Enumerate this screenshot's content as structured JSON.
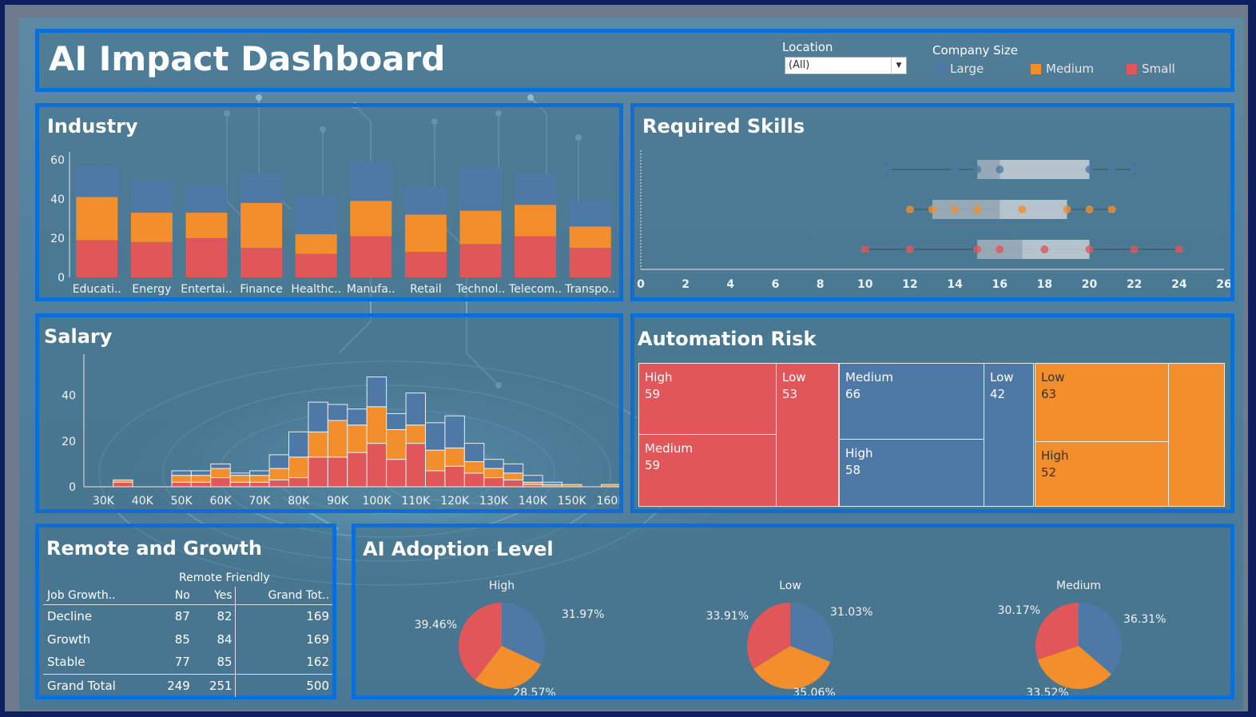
{
  "header": {
    "title": "AI Impact Dashboard",
    "location_label": "Location",
    "location_value": "(All)",
    "size_legend_title": "Company Size",
    "legend": [
      {
        "label": "Large",
        "color": "#4e79a7"
      },
      {
        "label": "Medium",
        "color": "#f28e2b"
      },
      {
        "label": "Small",
        "color": "#e15759"
      }
    ]
  },
  "colors": {
    "large": "#4e79a7",
    "medium": "#f28e2b",
    "small": "#e15759",
    "border": "#0a6fd8"
  },
  "industry": {
    "title": "Industry",
    "chart_data": {
      "type": "bar",
      "stacked": true,
      "categories": [
        "Educati..",
        "Energy",
        "Entertai..",
        "Finance",
        "Healthc..",
        "Manufa..",
        "Retail",
        "Technol..",
        "Telecom..",
        "Transpo.."
      ],
      "series": [
        {
          "name": "Small",
          "values": [
            19,
            18,
            20,
            15,
            12,
            21,
            13,
            17,
            21,
            15
          ]
        },
        {
          "name": "Medium",
          "values": [
            22,
            15,
            13,
            23,
            10,
            18,
            19,
            17,
            16,
            11
          ]
        },
        {
          "name": "Large",
          "values": [
            16,
            16,
            14,
            15,
            20,
            20,
            14,
            22,
            16,
            13
          ]
        }
      ],
      "ylim": [
        0,
        64
      ],
      "yticks": [
        0,
        20,
        40,
        60
      ]
    }
  },
  "skills": {
    "title": "Required Skills",
    "chart_data": {
      "type": "scatter",
      "subtype": "boxplot",
      "xlim": [
        0,
        26
      ],
      "xticks": [
        0,
        2,
        4,
        6,
        8,
        10,
        12,
        14,
        16,
        18,
        20,
        22,
        24,
        26
      ],
      "series": [
        {
          "name": "Large",
          "points": [
            11,
            14,
            15,
            16,
            20,
            21,
            22
          ],
          "min": 11,
          "q1": 15,
          "median": 16,
          "q3": 20,
          "max": 22
        },
        {
          "name": "Medium",
          "points": [
            12,
            13,
            14,
            15,
            17,
            19,
            20,
            21
          ],
          "min": 12,
          "q1": 13,
          "median": 16,
          "q3": 19,
          "max": 21
        },
        {
          "name": "Small",
          "points": [
            10,
            12,
            15,
            16,
            18,
            20,
            22,
            24
          ],
          "min": 10,
          "q1": 15,
          "median": 17,
          "q3": 20,
          "max": 24
        }
      ]
    }
  },
  "salary": {
    "title": "Salary",
    "chart_data": {
      "type": "bar",
      "stacked": true,
      "histogram": true,
      "bin_width": 5000,
      "x_start": 30000,
      "xticks": [
        "30K",
        "40K",
        "50K",
        "60K",
        "70K",
        "80K",
        "90K",
        "100K",
        "110K",
        "120K",
        "130K",
        "140K",
        "150K",
        "160K"
      ],
      "ylim": [
        0,
        58
      ],
      "yticks": [
        0,
        20,
        40
      ],
      "series": [
        {
          "name": "Small",
          "values": [
            0,
            2,
            0,
            0,
            2,
            2,
            4,
            2,
            2,
            3,
            4,
            13,
            13,
            15,
            19,
            12,
            19,
            7,
            9,
            6,
            4,
            3,
            1,
            0,
            0,
            0,
            0,
            0,
            0
          ]
        },
        {
          "name": "Medium",
          "values": [
            0,
            1,
            0,
            0,
            3,
            3,
            4,
            3,
            3,
            5,
            9,
            11,
            16,
            12,
            16,
            13,
            8,
            9,
            8,
            5,
            4,
            3,
            1,
            1,
            1,
            0,
            1,
            0,
            0
          ]
        },
        {
          "name": "Large",
          "values": [
            0,
            0,
            0,
            0,
            2,
            2,
            2,
            1,
            2,
            6,
            11,
            13,
            7,
            7,
            13,
            7,
            14,
            12,
            14,
            8,
            4,
            4,
            3,
            1,
            0,
            0,
            0,
            0,
            0
          ]
        }
      ]
    }
  },
  "automation": {
    "title": "Automation Risk",
    "cells": [
      {
        "label": "High",
        "value": "59",
        "group": "small"
      },
      {
        "label": "Low",
        "value": "53",
        "group": "small"
      },
      {
        "label": "Medium",
        "value": "59",
        "group": "small"
      },
      {
        "label": "Medium",
        "value": "66",
        "group": "large"
      },
      {
        "label": "Low",
        "value": "42",
        "group": "large"
      },
      {
        "label": "High",
        "value": "58",
        "group": "large"
      },
      {
        "label": "Low",
        "value": "63",
        "group": "medium"
      },
      {
        "label": "High",
        "value": "52",
        "group": "medium"
      }
    ]
  },
  "remote": {
    "title": "Remote and Growth",
    "col_group": "Remote Friendly",
    "row_header": "Job Growth..",
    "columns": [
      "No",
      "Yes",
      "Grand Tot.."
    ],
    "rows": [
      {
        "label": "Decline",
        "values": [
          "87",
          "82",
          "169"
        ]
      },
      {
        "label": "Growth",
        "values": [
          "85",
          "84",
          "169"
        ]
      },
      {
        "label": "Stable",
        "values": [
          "77",
          "85",
          "162"
        ]
      }
    ],
    "total": {
      "label": "Grand Total",
      "values": [
        "249",
        "251",
        "500"
      ]
    }
  },
  "adoption": {
    "title": "AI Adoption Level",
    "chart_data": {
      "type": "pie",
      "pies": [
        {
          "title": "High",
          "slices": [
            {
              "name": "Large",
              "pct": 31.97,
              "label": "31.97%"
            },
            {
              "name": "Medium",
              "pct": 28.57,
              "label": "28.57%"
            },
            {
              "name": "Small",
              "pct": 39.46,
              "label": "39.46%"
            }
          ]
        },
        {
          "title": "Low",
          "slices": [
            {
              "name": "Large",
              "pct": 31.03,
              "label": "31.03%"
            },
            {
              "name": "Medium",
              "pct": 35.06,
              "label": "35.06%"
            },
            {
              "name": "Small",
              "pct": 33.91,
              "label": "33.91%"
            }
          ]
        },
        {
          "title": "Medium",
          "slices": [
            {
              "name": "Large",
              "pct": 36.31,
              "label": "36.31%"
            },
            {
              "name": "Medium",
              "pct": 33.52,
              "label": "33.52%"
            },
            {
              "name": "Small",
              "pct": 30.17,
              "label": "30.17%"
            }
          ]
        }
      ]
    }
  }
}
